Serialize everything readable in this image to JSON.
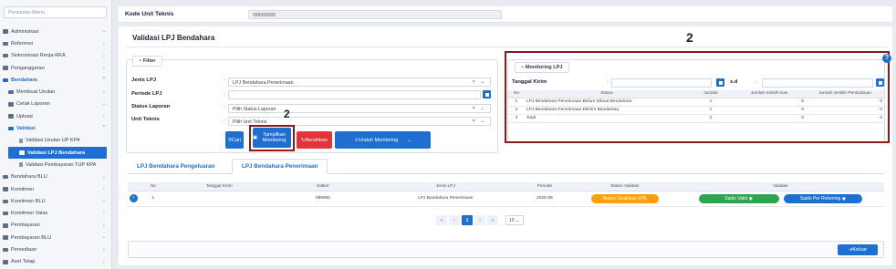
{
  "sidebar": {
    "search_placeholder": "Pencarian Menu",
    "items": [
      {
        "label": "Administrasi"
      },
      {
        "label": "Referensi"
      },
      {
        "label": "Sinkronisasi Renja-RKA"
      },
      {
        "label": "Penganggaran"
      },
      {
        "label": "Bendahara"
      },
      {
        "label": "Membuat Usulan"
      },
      {
        "label": "Cetak Laporan"
      },
      {
        "label": "Upload"
      },
      {
        "label": "Validasi"
      },
      {
        "label": "Validasi Usulan UP KPA"
      },
      {
        "label": "Validasi LPJ Bendahara"
      },
      {
        "label": "Validasi Pembayaran TUP KPA"
      },
      {
        "label": "Bendahara BLU"
      },
      {
        "label": "Komitmen"
      },
      {
        "label": "Komitmen BLU"
      },
      {
        "label": "Komitmen Valas"
      },
      {
        "label": "Pembayaran"
      },
      {
        "label": "Pembayaran BLU"
      },
      {
        "label": "Persediaan"
      },
      {
        "label": "Aset Tetap"
      }
    ]
  },
  "topbar": {
    "kode_label": "Kode Unit Teknis",
    "kode_value": "099092000"
  },
  "page": {
    "title": "Validasi LPJ Bendahara"
  },
  "filter": {
    "legend": "Filter",
    "jenis_label": "Jenis LPJ",
    "jenis_value": "LPJ Bendahara Penerimaan",
    "periode_label": "Periode LPJ",
    "periode_value": "",
    "status_label": "Status Laporan",
    "status_value": "Pilih Status Laporan",
    "unit_label": "Unit Teknis",
    "unit_value": "Pilih Unit Teknis",
    "btn_cari": "Cari",
    "btn_tampilkan": "Tampilkan Monitoring",
    "btn_bersihkan": "Bersihkan",
    "btn_unduh": "Unduh Monitoring"
  },
  "monitoring": {
    "legend": "Monitoring LPJ",
    "tanggal_label": "Tanggal Kirim",
    "sd_label": "s.d",
    "headers": [
      "No",
      "Status",
      "Jumlah",
      "Jumlah Selisih Kas",
      "Jumlah Selisih Pembukuan"
    ],
    "rows": [
      [
        "1",
        "LPJ Bendahara Penerimaan Belum Dibuat Bendahara",
        "1",
        "0",
        "0"
      ],
      [
        "2",
        "LPJ Bendahara Penerimaan Dikirim Bendahara",
        "1",
        "0",
        "0"
      ],
      [
        "3",
        "Total",
        "2",
        "0",
        "0"
      ]
    ]
  },
  "annotations": {
    "num_left": "2",
    "num_right": "2"
  },
  "tabs": [
    "LPJ Bendahara Pengeluaran",
    "LPJ Bendahara Penerimaan"
  ],
  "table": {
    "headers": [
      "No",
      "Tanggal Kirim",
      "Satker",
      "Jenis LPJ",
      "Periode",
      "Status Validasi",
      "Validasi"
    ],
    "row": {
      "no": "1",
      "tanggal": "",
      "satker": "099092",
      "jenis": "LPJ Bendahara Penerimaan",
      "periode": "2025-08",
      "status": "Belum Divalidasi KPA",
      "btn_saldo_valid": "Saldo Valid",
      "btn_saldo_rekening": "Saldo Per Rekening"
    }
  },
  "pager": {
    "current": "1",
    "page_size": "10"
  },
  "footer": {
    "btn_keluar": "Keluar"
  }
}
